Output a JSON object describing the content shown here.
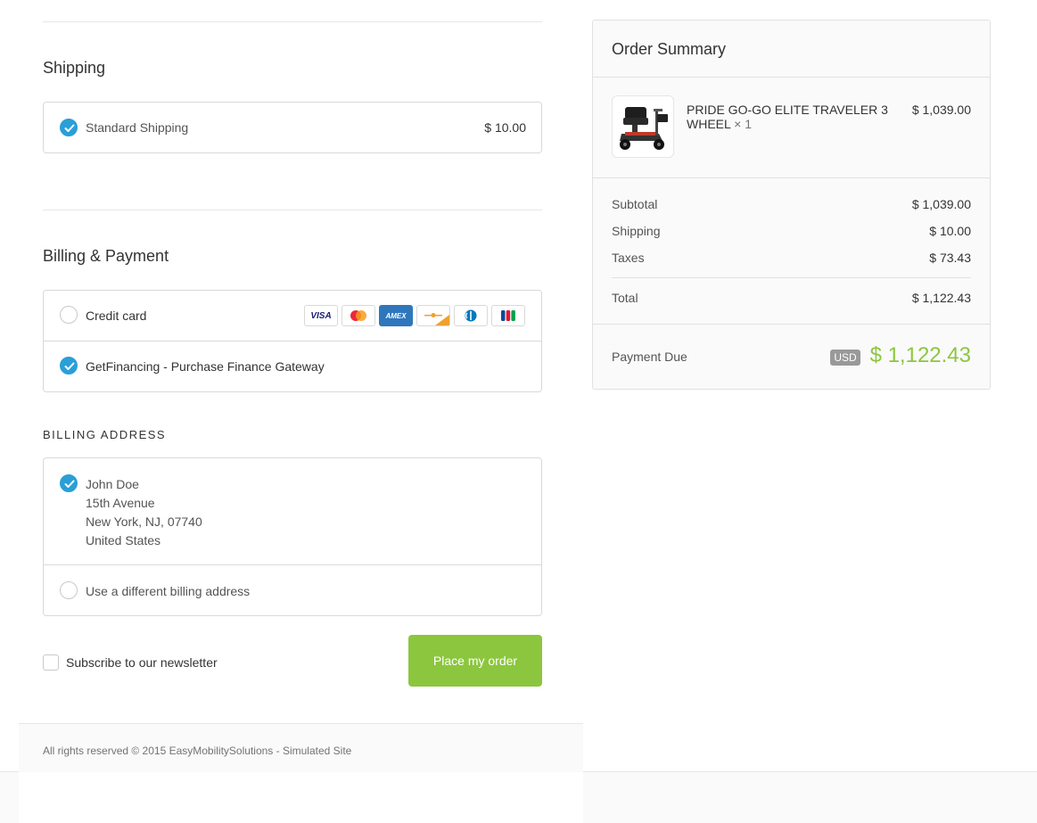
{
  "shipping": {
    "title": "Shipping",
    "option_label": "Standard Shipping",
    "option_price": "$ 10.00"
  },
  "payment": {
    "title": "Billing & Payment",
    "credit_card_label": "Credit card",
    "getfinancing_label": "GetFinancing - Purchase Finance Gateway",
    "card_icons": [
      "visa-card-icon",
      "mastercard-icon",
      "amex-card-icon",
      "discover-card-icon",
      "diners-club-icon",
      "jcb-card-icon"
    ],
    "visa_text": "VISA",
    "amex_text": "AMEX"
  },
  "billing_address": {
    "heading": "BILLING ADDRESS",
    "name": "John Doe",
    "street": "15th Avenue",
    "city_line": "New York, NJ, 07740",
    "country": "United States",
    "different_label": "Use a different billing address"
  },
  "newsletter_label": "Subscribe to our newsletter",
  "place_order_label": "Place my order",
  "footer_text": "All rights reserved © 2015 EasyMobilitySolutions - Simulated Site",
  "summary": {
    "title": "Order Summary",
    "product_name": "PRIDE GO-GO ELITE TRAVELER 3 WHEEL",
    "product_qty": "× 1",
    "product_price": "$ 1,039.00",
    "subtotal_label": "Subtotal",
    "subtotal_value": "$ 1,039.00",
    "shipping_label": "Shipping",
    "shipping_value": "$ 10.00",
    "taxes_label": "Taxes",
    "taxes_value": "$ 73.43",
    "total_label": "Total",
    "total_value": "$ 1,122.43",
    "payment_due_label": "Payment Due",
    "currency": "USD",
    "payment_due_value": "$ 1,122.43"
  },
  "colors": {
    "accent_blue": "#2a9fd6",
    "accent_green": "#8cc63f"
  }
}
